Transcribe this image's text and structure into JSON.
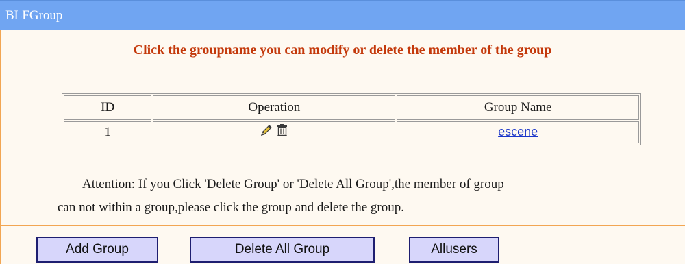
{
  "window": {
    "title": "BLFGroup"
  },
  "instruction": "Click the groupname you can modify or delete the member of the group",
  "table": {
    "headers": [
      "ID",
      "Operation",
      "Group Name"
    ],
    "rows": [
      {
        "id": "1",
        "operation_icons": [
          "pencil-icon",
          "trash-icon"
        ],
        "group_name": "escene"
      }
    ]
  },
  "attention": {
    "line1": "Attention: If you Click 'Delete Group' or 'Delete All Group',the member of group",
    "line2": "can not within a group,please click the group and delete the group."
  },
  "buttons": {
    "add_group": "Add Group",
    "delete_all_group": "Delete All Group",
    "allusers": "Allusers"
  },
  "colors": {
    "title_bar": "#70a5f2",
    "instruction_text": "#c4390b",
    "link": "#1a35c9",
    "button_bg": "#d7d6fb",
    "divider": "#f2a653"
  }
}
